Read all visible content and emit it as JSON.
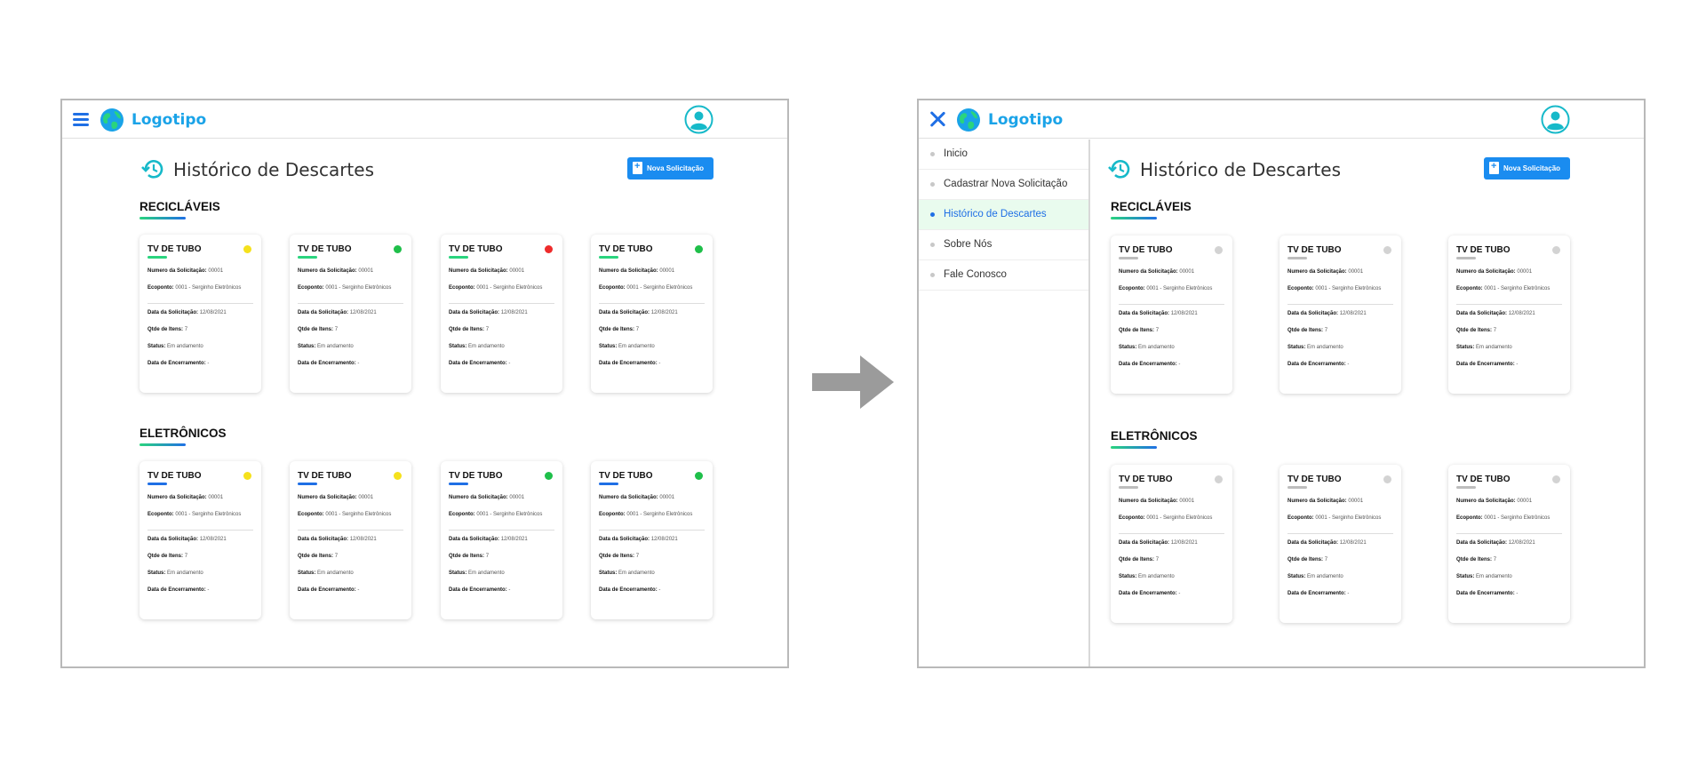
{
  "logo_text": "Logotipo",
  "page_title": "Histórico de Descartes",
  "new_button_label": "Nova Solicitação",
  "sections": {
    "recyclables": "RECICLÁVEIS",
    "electronics": "ELETRÔNICOS"
  },
  "card": {
    "title": "TV DE TUBO",
    "numero_label": "Numero da Solicitação:",
    "numero_value": "00001",
    "ecoponto_label": "Ecoponto:",
    "ecoponto_value": "0001 - Serginho Eletrônicos",
    "data_label": "Data da Solicitação:",
    "data_value": "12/08/2021",
    "qtde_label": "Qtde de Itens:",
    "qtde_value": "7",
    "status_label": "Status:",
    "status_value": "Em andamento",
    "encerramento_label": "Data de Encerramento:",
    "encerramento_value": "-"
  },
  "status_colors": {
    "recyclables": [
      "#f5e11c",
      "#1fbf4a",
      "#ee2b2b",
      "#1fbf4a"
    ],
    "electronics": [
      "#f5e11c",
      "#f5e11c",
      "#1fbf4a",
      "#1fbf4a"
    ],
    "menu_open": "#d3d3d3"
  },
  "accent_colors": {
    "recyclables_bar": "#2ad47e",
    "electronics_bar": "#1f6fe5",
    "menu_open_bar": "#bdbdbd"
  },
  "sidebar": {
    "items": [
      {
        "label": "Inicio",
        "active": false
      },
      {
        "label": "Cadastrar Nova Solicitação",
        "active": false
      },
      {
        "label": "Histórico de Descartes",
        "active": true
      },
      {
        "label": "Sobre Nós",
        "active": false
      },
      {
        "label": "Fale Conosco",
        "active": false
      }
    ]
  },
  "icons": {
    "menu": "hamburger-icon",
    "close": "close-icon",
    "logo": "globe-icon",
    "user": "user-avatar-icon",
    "history": "history-icon",
    "new": "new-document-icon",
    "transition": "right-arrow-icon"
  }
}
